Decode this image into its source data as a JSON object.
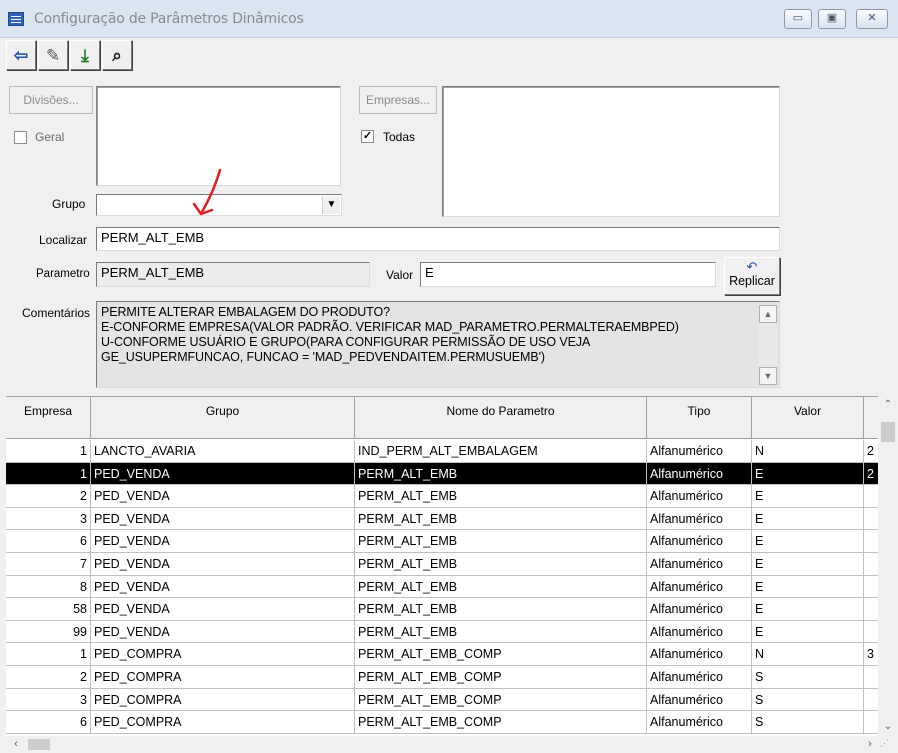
{
  "window": {
    "title": "Configuração de Parâmetros Dinâmicos",
    "buttons": [
      "minimize",
      "maximize",
      "close"
    ]
  },
  "toolbar": {
    "items": [
      {
        "name": "exit-icon",
        "glyph": "⇦"
      },
      {
        "name": "edit-icon",
        "glyph": "✎"
      },
      {
        "name": "save-icon",
        "glyph": "⤓"
      },
      {
        "name": "search-binoculars-icon",
        "glyph": "⌕"
      }
    ]
  },
  "filters": {
    "divisoes_button": "Divisões...",
    "geral_label": "Geral",
    "geral_checked": false,
    "empresas_button": "Empresas...",
    "todas_label": "Todas",
    "todas_checked": true,
    "grupo_label": "Grupo",
    "grupo_value": ""
  },
  "localizar": {
    "label": "Localizar",
    "value": "PERM_ALT_EMB"
  },
  "parametro": {
    "label": "Parametro",
    "value": "PERM_ALT_EMB"
  },
  "valor": {
    "label": "Valor",
    "value": "E"
  },
  "replicar": {
    "label": "Replicar"
  },
  "comentarios": {
    "label": "Comentários",
    "lines": [
      "PERMITE ALTERAR EMBALAGEM DO PRODUTO?",
      "E-CONFORME EMPRESA(VALOR PADRÃO. VERIFICAR MAD_PARAMETRO.PERMALTERAEMBPED)",
      "U-CONFORME USUÁRIO E GRUPO(PARA CONFIGURAR PERMISSÃO DE USO VEJA",
      "GE_USUPERMFUNCAO, FUNCAO = 'MAD_PEDVENDAITEM.PERMUSUEMB')"
    ]
  },
  "grid": {
    "columns": [
      "Empresa",
      "Grupo",
      "Nome do Parametro",
      "Tipo",
      "Valor"
    ],
    "selected_row": 1,
    "rows": [
      {
        "empresa": "1",
        "grupo": "LANCTO_AVARIA",
        "nome": "IND_PERM_ALT_EMBALAGEM",
        "tipo": "Alfanumérico",
        "valor": "N",
        "extra": "2"
      },
      {
        "empresa": "1",
        "grupo": "PED_VENDA",
        "nome": "PERM_ALT_EMB",
        "tipo": "Alfanumérico",
        "valor": "E",
        "extra": "2"
      },
      {
        "empresa": "2",
        "grupo": "PED_VENDA",
        "nome": "PERM_ALT_EMB",
        "tipo": "Alfanumérico",
        "valor": "E",
        "extra": ""
      },
      {
        "empresa": "3",
        "grupo": "PED_VENDA",
        "nome": "PERM_ALT_EMB",
        "tipo": "Alfanumérico",
        "valor": "E",
        "extra": ""
      },
      {
        "empresa": "6",
        "grupo": "PED_VENDA",
        "nome": "PERM_ALT_EMB",
        "tipo": "Alfanumérico",
        "valor": "E",
        "extra": ""
      },
      {
        "empresa": "7",
        "grupo": "PED_VENDA",
        "nome": "PERM_ALT_EMB",
        "tipo": "Alfanumérico",
        "valor": "E",
        "extra": ""
      },
      {
        "empresa": "8",
        "grupo": "PED_VENDA",
        "nome": "PERM_ALT_EMB",
        "tipo": "Alfanumérico",
        "valor": "E",
        "extra": ""
      },
      {
        "empresa": "58",
        "grupo": "PED_VENDA",
        "nome": "PERM_ALT_EMB",
        "tipo": "Alfanumérico",
        "valor": "E",
        "extra": ""
      },
      {
        "empresa": "99",
        "grupo": "PED_VENDA",
        "nome": "PERM_ALT_EMB",
        "tipo": "Alfanumérico",
        "valor": "E",
        "extra": ""
      },
      {
        "empresa": "1",
        "grupo": "PED_COMPRA",
        "nome": "PERM_ALT_EMB_COMP",
        "tipo": "Alfanumérico",
        "valor": "N",
        "extra": "3"
      },
      {
        "empresa": "2",
        "grupo": "PED_COMPRA",
        "nome": "PERM_ALT_EMB_COMP",
        "tipo": "Alfanumérico",
        "valor": "S",
        "extra": ""
      },
      {
        "empresa": "3",
        "grupo": "PED_COMPRA",
        "nome": "PERM_ALT_EMB_COMP",
        "tipo": "Alfanumérico",
        "valor": "S",
        "extra": ""
      },
      {
        "empresa": "6",
        "grupo": "PED_COMPRA",
        "nome": "PERM_ALT_EMB_COMP",
        "tipo": "Alfanumérico",
        "valor": "S",
        "extra": ""
      }
    ]
  },
  "colors": {
    "selection": "#000000",
    "annotation_arrow": "#e02020"
  }
}
